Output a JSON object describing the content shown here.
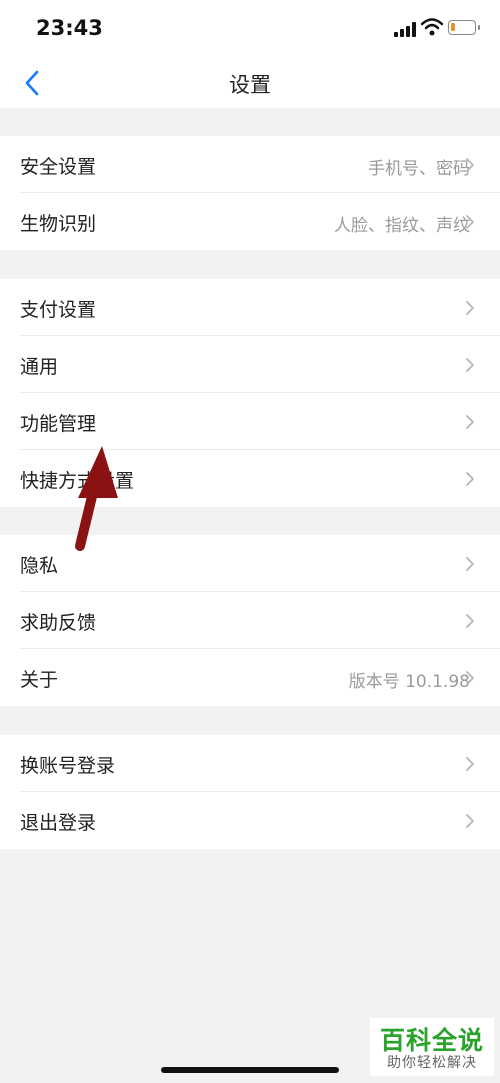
{
  "status_bar": {
    "time": "23:43"
  },
  "nav": {
    "title": "设置"
  },
  "groups": [
    [
      {
        "label": "安全设置",
        "value": "手机号、密码"
      },
      {
        "label": "生物识别",
        "value": "人脸、指纹、声纹"
      }
    ],
    [
      {
        "label": "支付设置"
      },
      {
        "label": "通用"
      },
      {
        "label": "功能管理"
      },
      {
        "label": "快捷方式设置"
      }
    ],
    [
      {
        "label": "隐私"
      },
      {
        "label": "求助反馈"
      },
      {
        "label": "关于",
        "value": "版本号 10.1.98"
      }
    ],
    [
      {
        "label": "换账号登录"
      },
      {
        "label": "退出登录"
      }
    ]
  ],
  "watermark": {
    "title": "百科全说",
    "subtitle": "助你轻松解决"
  },
  "colors": {
    "accent": "#1677ff",
    "arrow": "#8b1212",
    "watermark_green": "#2aa32a"
  }
}
